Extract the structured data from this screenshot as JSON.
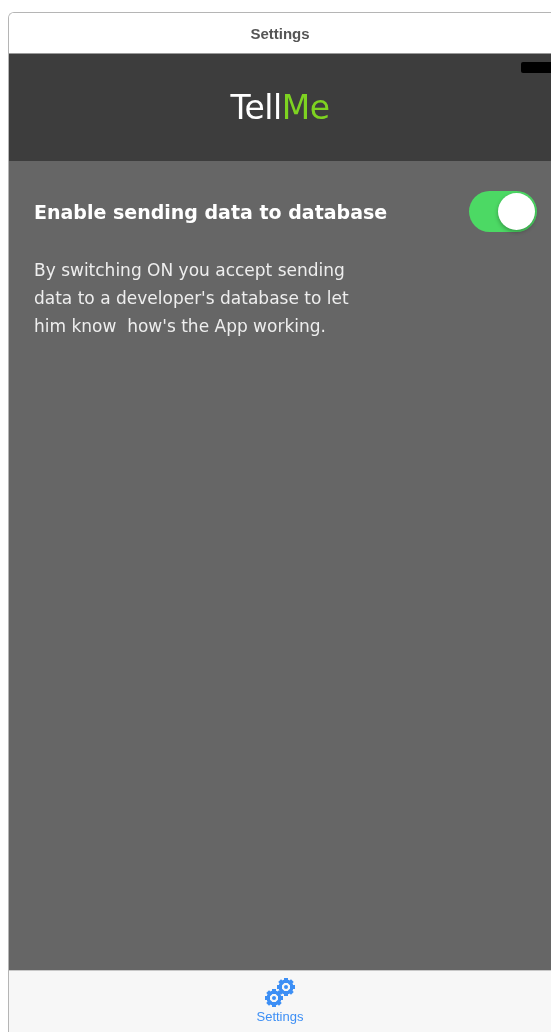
{
  "window": {
    "title": "Settings"
  },
  "header": {
    "logo": [
      {
        "text": "Tell",
        "color": "#ffffff"
      },
      {
        "text": "Me",
        "color": "#7ed321"
      }
    ]
  },
  "setting": {
    "label": "Enable sending data to database",
    "on": true,
    "description": "By switching ON you accept sending data to a developer's database to let him know  how's the App working."
  },
  "tab_bar": [
    {
      "label": "Settings",
      "selected": true
    }
  ]
}
